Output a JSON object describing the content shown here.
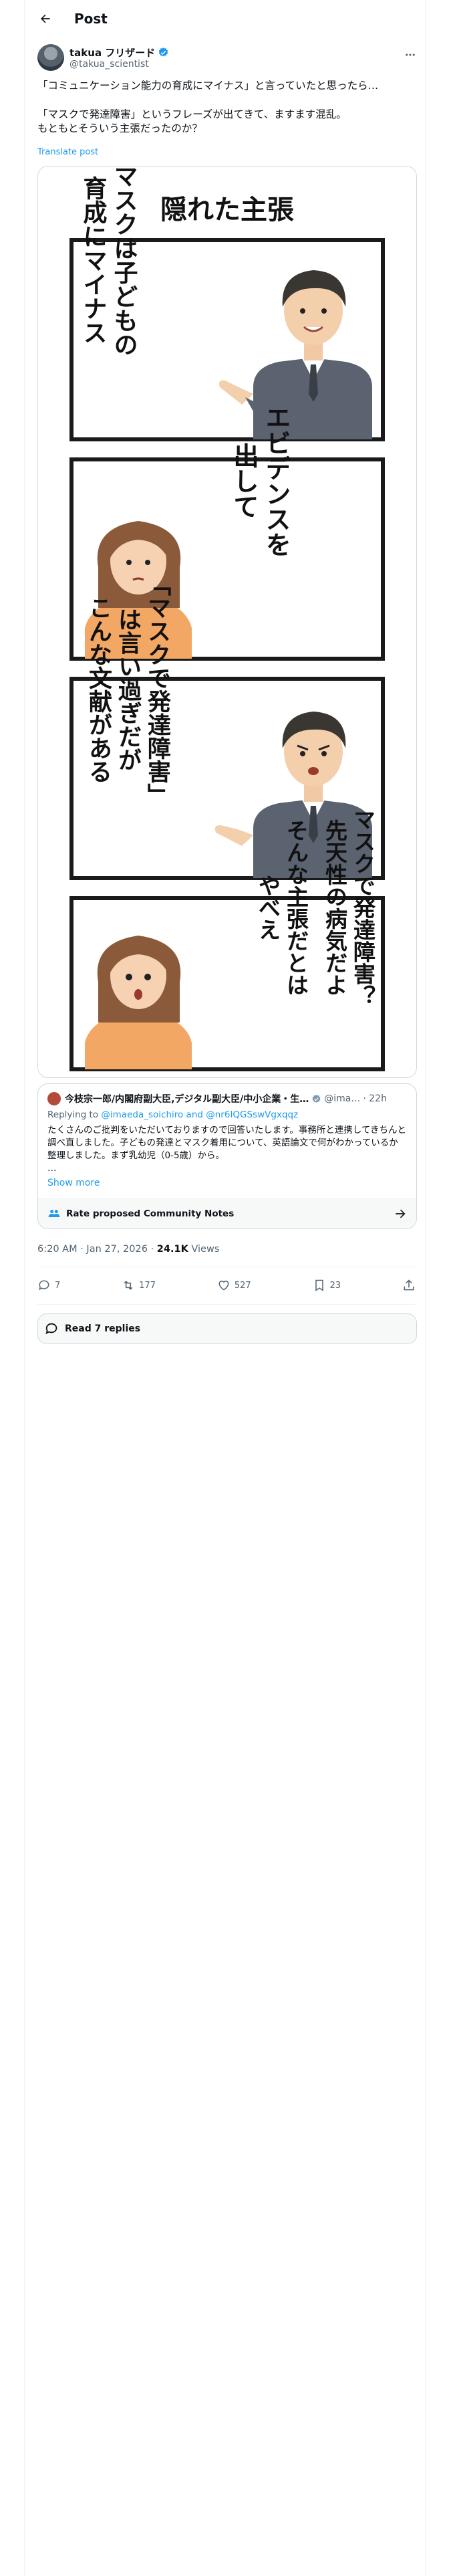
{
  "header": {
    "title": "Post"
  },
  "post": {
    "author_name": "takua フリザード",
    "author_handle": "@takua_scientist",
    "text_lines": [
      "「コミュニケーション能力の育成にマイナス」と言っていたと思ったら…",
      "",
      "「マスクで発達障害」というフレーズが出てきて、ますます混乱。",
      "もともとそういう主張だったのか？"
    ],
    "translate_label": "Translate post"
  },
  "comic": {
    "title": "隠れた主張",
    "panels": [
      {
        "lines": [
          "マスクは子どもの",
          "育成にマイナス"
        ]
      },
      {
        "lines": [
          "エビデンスを",
          "出して"
        ]
      },
      {
        "lines": [
          "「マスクで発達障害」",
          "は言い過ぎだが",
          "こんな文献がある"
        ]
      },
      {
        "lines": [
          "マスクで発達障害？",
          "先天性の病気だよ",
          "そんな主張だとは",
          "やべえ"
        ]
      }
    ]
  },
  "quoted": {
    "name": "今枝宗一郎/内閣府副大臣,デジタル副大臣/中小企業・生…",
    "handle": "@ima…",
    "time": "· 22h",
    "reply_prefix": "Replying to ",
    "reply_targets": "@imaeda_soichiro and @nr6IQGSswVgxqqz",
    "body": "たくさんのご批判をいただいておりますので回答いたします。事務所と連携してきちんと調べ直しました。子どもの発達とマスク着用について、英語論文で何がわかっているか整理しました。まず乳幼児（0-5歳）から。",
    "ellipsis": "…",
    "show_more": "Show more",
    "community_notes_label": "Rate proposed Community Notes"
  },
  "meta": {
    "time": "6:20 AM · Jan 27, 2026 · ",
    "views_count": "24.1K",
    "views_label": " Views"
  },
  "actions": {
    "replies": "7",
    "reposts": "177",
    "likes": "527",
    "bookmarks": "23"
  },
  "read_replies_label": "Read 7 replies",
  "colors": {
    "accent": "#1d9bf0",
    "text": "#0f1419",
    "secondary": "#536471",
    "border": "#cfd9de"
  }
}
